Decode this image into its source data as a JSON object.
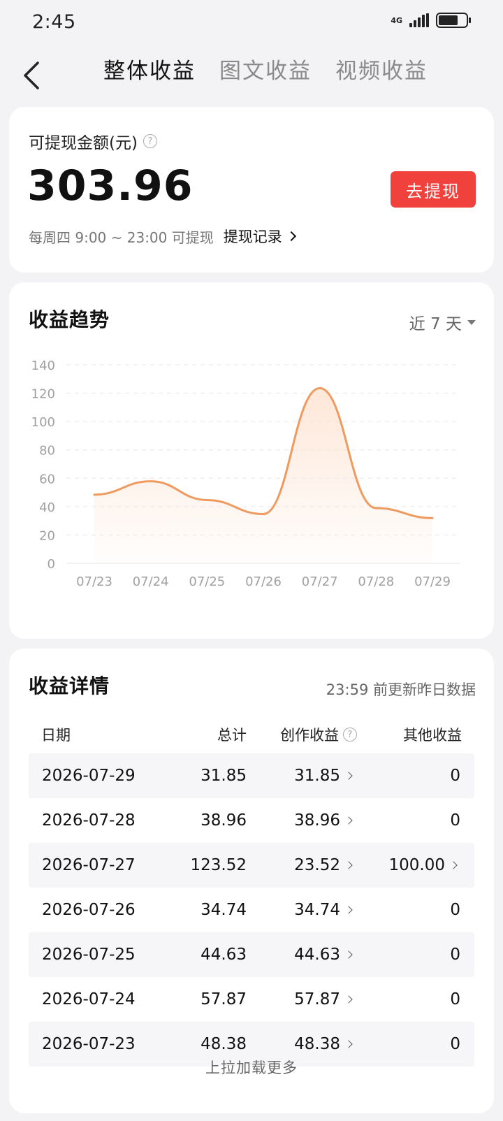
{
  "status_bar": {
    "time": "2:45",
    "network": "4G",
    "battery_level": 0.7
  },
  "nav": {
    "tabs": [
      {
        "label": "整体收益",
        "active": true
      },
      {
        "label": "图文收益",
        "active": false
      },
      {
        "label": "视频收益",
        "active": false
      }
    ]
  },
  "balance": {
    "label": "可提现金额(元)",
    "amount": "303.96",
    "withdraw_label": "去提现",
    "note": "每周四 9:00 ~ 23:00 可提现",
    "record_label": "提现记录"
  },
  "trend": {
    "title": "收益趋势",
    "range_label": "近 7 天"
  },
  "chart_data": {
    "type": "area",
    "categories": [
      "07/23",
      "07/24",
      "07/25",
      "07/26",
      "07/27",
      "07/28",
      "07/29"
    ],
    "values": [
      48.38,
      57.87,
      44.63,
      34.74,
      123.52,
      38.96,
      31.85
    ],
    "yticks": [
      0,
      20,
      40,
      60,
      80,
      100,
      120,
      140
    ],
    "ylim": [
      0,
      140
    ],
    "grid": true,
    "colors": {
      "line": "#ef9a5f",
      "fill_top": "#fde3d2",
      "grid": "#e6e6e6",
      "tick": "#a0a0a0"
    }
  },
  "details": {
    "title": "收益详情",
    "note": "23:59 前更新昨日数据",
    "columns": [
      "日期",
      "总计",
      "创作收益",
      "其他收益"
    ],
    "rows": [
      {
        "date": "2026-07-29",
        "total": "31.85",
        "creation": "31.85",
        "other": "0"
      },
      {
        "date": "2026-07-28",
        "total": "38.96",
        "creation": "38.96",
        "other": "0"
      },
      {
        "date": "2026-07-27",
        "total": "123.52",
        "creation": "23.52",
        "other": "100.00"
      },
      {
        "date": "2026-07-26",
        "total": "34.74",
        "creation": "34.74",
        "other": "0"
      },
      {
        "date": "2026-07-25",
        "total": "44.63",
        "creation": "44.63",
        "other": "0"
      },
      {
        "date": "2026-07-24",
        "total": "57.87",
        "creation": "57.87",
        "other": "0"
      },
      {
        "date": "2026-07-23",
        "total": "48.38",
        "creation": "48.38",
        "other": "0"
      }
    ],
    "load_more": "上拉加载更多"
  }
}
